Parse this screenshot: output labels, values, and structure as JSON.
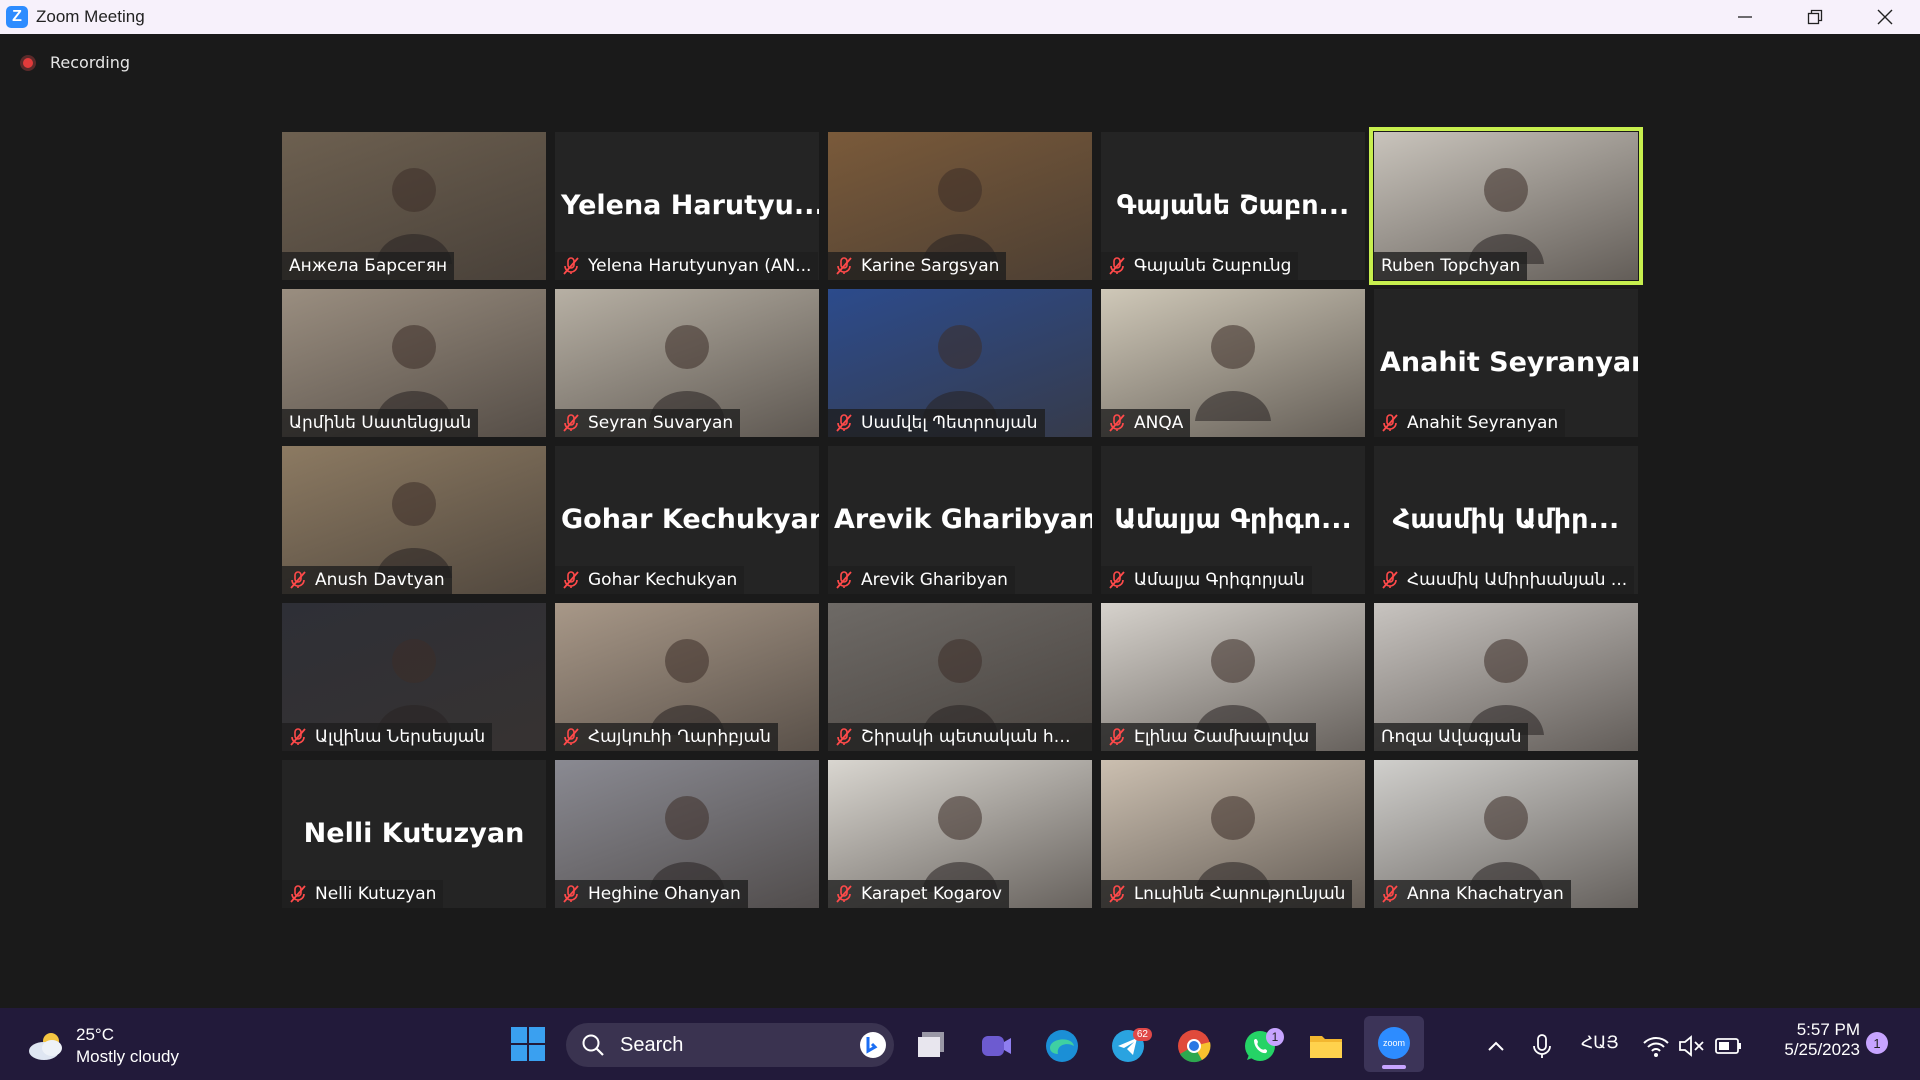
{
  "window": {
    "title": "Zoom Meeting"
  },
  "recording": {
    "label": "Recording"
  },
  "participants": [
    {
      "display": "video",
      "name": "Анжела Барсегян",
      "muted": false,
      "bg": "#6d6050"
    },
    {
      "display": "text",
      "big": "Yelena  Harutyu...",
      "name": "Yelena Harutyunyan (AN...",
      "muted": true
    },
    {
      "display": "video",
      "name": "Karine Sargsyan",
      "muted": true,
      "bg": "#7a5a3a"
    },
    {
      "display": "text",
      "big": "Գայանե  Շաբո...",
      "name": "Գայանե Շաբունց",
      "muted": true
    },
    {
      "display": "video",
      "name": "Ruben Topchyan",
      "muted": false,
      "active": true,
      "bg": "#c9c4bc"
    },
    {
      "display": "video",
      "name": "Արմինե Սատենցյան",
      "muted": false,
      "bg": "#9a8e80"
    },
    {
      "display": "video",
      "name": "Seyran Suvaryan",
      "muted": true,
      "bg": "#b7b0a4"
    },
    {
      "display": "video",
      "name": "Սամվել Պետրոսյան",
      "muted": true,
      "bg": "#2c4b8c"
    },
    {
      "display": "video",
      "name": "ANQA",
      "muted": true,
      "bg": "#cfc8b8"
    },
    {
      "display": "text",
      "big": "Anahit Seyranyan",
      "name": "Anahit Seyranyan",
      "muted": true
    },
    {
      "display": "video",
      "name": "Anush Davtyan",
      "muted": true,
      "bg": "#8c7a62"
    },
    {
      "display": "text",
      "big": "Gohar Kechukyan",
      "name": "Gohar Kechukyan",
      "muted": true
    },
    {
      "display": "text",
      "big": "Arevik Gharibyan",
      "name": "Arevik Gharibyan",
      "muted": true
    },
    {
      "display": "text",
      "big": "Ամալյա  Գրիգո...",
      "name": "Ամալյա Գրիգորյան",
      "muted": true
    },
    {
      "display": "text",
      "big": "Հասմիկ  Ամիր...",
      "name": "Հասմիկ Ամիրխանյան ...",
      "muted": true
    },
    {
      "display": "video",
      "name": "Ալվինա Ներսեսյան",
      "muted": true,
      "bg": "#2e2f36"
    },
    {
      "display": "video",
      "name": "Հայկուհի Ղարիբյան",
      "muted": true,
      "bg": "#a89888"
    },
    {
      "display": "video",
      "name": "Շիրակի պետական հա...",
      "muted": true,
      "bg": "#6e6a66"
    },
    {
      "display": "video",
      "name": "Էլինա Շամխալովա",
      "muted": true,
      "bg": "#d6d2cc"
    },
    {
      "display": "video",
      "name": "Ռոզա Ավագյան",
      "muted": false,
      "bg": "#c8c4c0"
    },
    {
      "display": "text",
      "big": "Nelli Kutuzyan",
      "name": "Nelli Kutuzyan",
      "muted": true
    },
    {
      "display": "video",
      "name": "Heghine Ohanyan",
      "muted": true,
      "bg": "#8a8a92"
    },
    {
      "display": "video",
      "name": "Karapet Kogarov",
      "muted": true,
      "bg": "#d9d6d0"
    },
    {
      "display": "video",
      "name": "Լուսինե Հարությունյան",
      "muted": true,
      "bg": "#cbbfb0"
    },
    {
      "display": "video",
      "name": "Anna Khachatryan",
      "muted": true,
      "bg": "#d0cfcc"
    }
  ],
  "taskbar": {
    "weather": {
      "temp": "25°C",
      "desc": "Mostly cloudy"
    },
    "search_label": "Search",
    "telegram_badge": "62",
    "whatsapp_badge": "1",
    "zoom_label": "zoom",
    "language": "ՀԱՅ",
    "time": "5:57 PM",
    "date": "5/25/2023",
    "notifications": "1"
  }
}
